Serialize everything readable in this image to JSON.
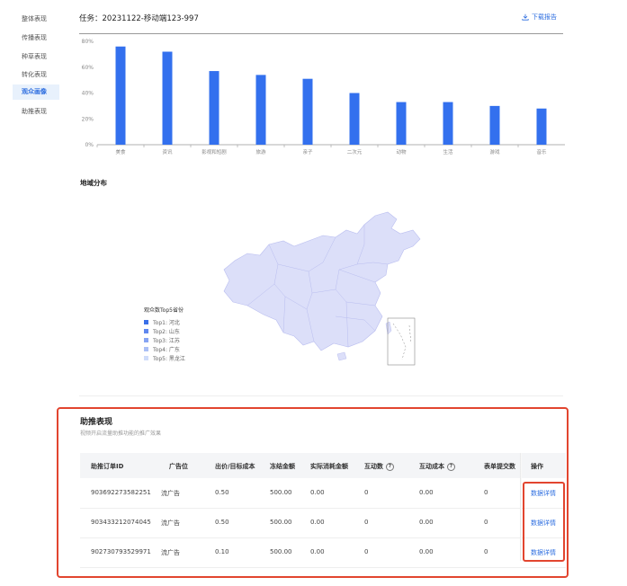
{
  "sidebar": {
    "items": [
      {
        "label": "整体表现",
        "active": false
      },
      {
        "label": "传播表现",
        "active": false
      },
      {
        "label": "种草表现",
        "active": false
      },
      {
        "label": "转化表现",
        "active": false
      },
      {
        "label": "观众画像",
        "active": true
      },
      {
        "label": "助推表现",
        "active": false
      }
    ]
  },
  "header": {
    "task_title": "任务：20231122-移动端123-997",
    "download_label": "下载报告",
    "download_icon": "download-icon"
  },
  "chart_data": {
    "type": "bar",
    "categories": [
      "美食",
      "资讯",
      "影视和短剧",
      "旅游",
      "亲子",
      "二次元",
      "动物",
      "生活",
      "游戏",
      "音乐"
    ],
    "values": [
      76,
      72,
      57,
      54,
      51,
      40,
      33,
      33,
      30,
      28
    ],
    "ylim": [
      0,
      80
    ],
    "yticks": [
      "0%",
      "20%",
      "40%",
      "60%",
      "80%"
    ],
    "grid": false,
    "bar_color": "#3370ee"
  },
  "map_section": {
    "title": "地域分布",
    "legend_title": "观众数Top5省份",
    "legend": [
      {
        "label": "Top1: 河北",
        "color": "#3a6fe8"
      },
      {
        "label": "Top2: 山东",
        "color": "#5f87ef"
      },
      {
        "label": "Top3: 江苏",
        "color": "#86a4f3"
      },
      {
        "label": "Top4: 广东",
        "color": "#aabff6"
      },
      {
        "label": "Top5: 黑龙江",
        "color": "#cfdcfa"
      }
    ],
    "map_fill": "#dcdff9"
  },
  "boost": {
    "title": "助推表现",
    "subtitle": "视频开启流量助推功能的推广效果",
    "columns": [
      "助推订单ID",
      "广告位",
      "出价/目标成本",
      "冻结金额",
      "实际消耗金额",
      "互动数",
      "互动成本",
      "表单提交数",
      "操作"
    ],
    "rows": [
      {
        "id": "903692273582251",
        "slot": "流广告",
        "bid": "0.50",
        "frozen": "500.00",
        "spent": "0.00",
        "interactions": "0",
        "cost": "0.00",
        "forms": "0",
        "action": "数据详情"
      },
      {
        "id": "903433212074045",
        "slot": "流广告",
        "bid": "0.50",
        "frozen": "500.00",
        "spent": "0.00",
        "interactions": "0",
        "cost": "0.00",
        "forms": "0",
        "action": "数据详情"
      },
      {
        "id": "902730793529971",
        "slot": "流广告",
        "bid": "0.10",
        "frozen": "500.00",
        "spent": "0.00",
        "interactions": "0",
        "cost": "0.00",
        "forms": "0",
        "action": "数据详情"
      }
    ],
    "help_icon": "question-circle-icon"
  },
  "colors": {
    "accent": "#2f6fe0",
    "highlight_border": "#e2452f"
  }
}
